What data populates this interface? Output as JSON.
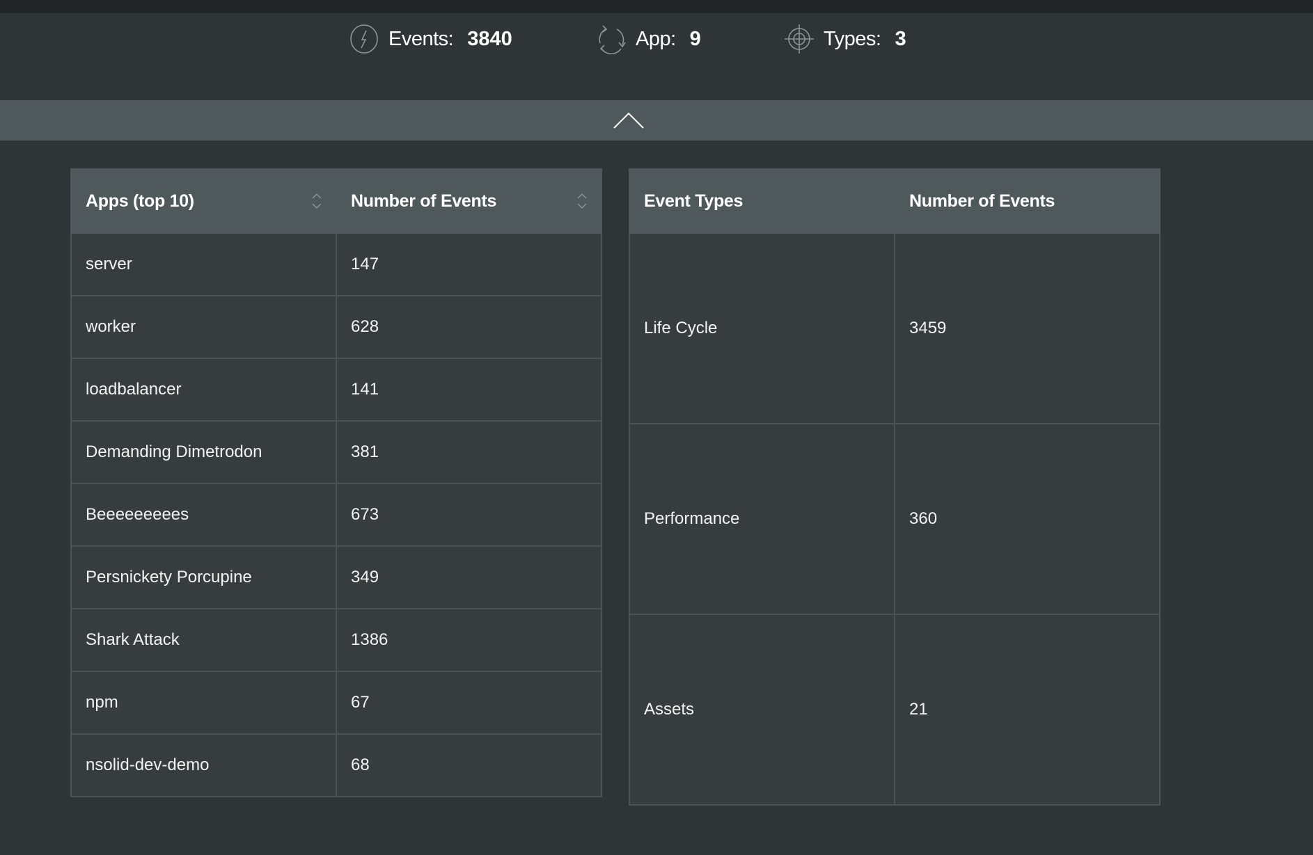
{
  "summary": {
    "events": {
      "icon": "lightning-icon",
      "label": "Events:",
      "value": "3840"
    },
    "apps": {
      "icon": "refresh-cycle-icon",
      "label": "App:",
      "value": "9"
    },
    "types": {
      "icon": "crosshair-target-icon",
      "label": "Types:",
      "value": "3"
    }
  },
  "collapse": {
    "icon": "chevron-up-icon"
  },
  "colors": {
    "background": "#2f3436",
    "top_strip": "#222628",
    "header_row": "#4f585a",
    "cell": "#373c3f",
    "border": "#4b5356",
    "icon_stroke": "#8a9895"
  },
  "apps_table": {
    "columns": [
      {
        "label": "Apps (top 10)",
        "sortable": true
      },
      {
        "label": "Number of Events",
        "sortable": true
      }
    ],
    "rows": [
      {
        "app": "server",
        "events": "147"
      },
      {
        "app": "worker",
        "events": "628"
      },
      {
        "app": "loadbalancer",
        "events": "141"
      },
      {
        "app": "Demanding Dimetrodon",
        "events": "381"
      },
      {
        "app": "Beeeeeeeees",
        "events": "673"
      },
      {
        "app": "Persnickety Porcupine",
        "events": "349"
      },
      {
        "app": "Shark Attack",
        "events": "1386"
      },
      {
        "app": "npm",
        "events": "67"
      },
      {
        "app": "nsolid-dev-demo",
        "events": "68"
      }
    ]
  },
  "types_table": {
    "columns": [
      {
        "label": "Event Types"
      },
      {
        "label": "Number of Events"
      }
    ],
    "rows": [
      {
        "type": "Life Cycle",
        "events": "3459"
      },
      {
        "type": "Performance",
        "events": "360"
      },
      {
        "type": "Assets",
        "events": "21"
      }
    ]
  }
}
